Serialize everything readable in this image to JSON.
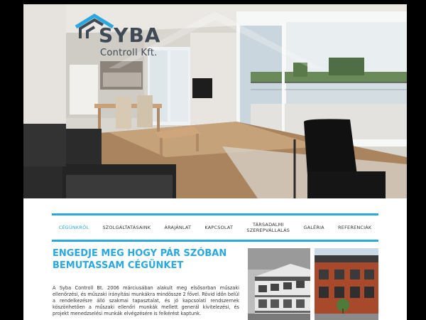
{
  "logo": {
    "name": "SYBA",
    "sub": "Controll Kft.",
    "accent_color": "#29a9df"
  },
  "nav": {
    "items": [
      {
        "line1": "CÉGÜNKRŐL",
        "line2": "",
        "active": true
      },
      {
        "line1": "SZOLGÁLTATÁSAINK",
        "line2": "",
        "active": false
      },
      {
        "line1": "ÁRAJÁNLAT",
        "line2": "",
        "active": false
      },
      {
        "line1": "KAPCSOLAT",
        "line2": "",
        "active": false
      },
      {
        "line1": "TÁRSADALMI",
        "line2": "SZEREPVÁLLALÁS",
        "active": false
      },
      {
        "line1": "GALÉRIA",
        "line2": "",
        "active": false
      },
      {
        "line1": "REFERENCIÁK",
        "line2": "",
        "active": false
      }
    ]
  },
  "main": {
    "headline": "ENGEDJE MEG HOGY PÁR SZÓBAN BEMUTASSAM CÉGÜNKET",
    "intro": "A Syba Controll Bt. 2006 márciusában alakult meg elsősorban műszaki ellenőrzési, és műszaki irányítási munkákra mindössze 2 fővel. Rövid időn belül a rendelkezésre álló szakmai tapasztalat, és jó kapcsolati rendszernek köszönhetően a műszaki ellenőri munkák mellett generál kivitelezési, és projekt menedzselési munkák elvégzésére is felkérést kaptunk."
  }
}
